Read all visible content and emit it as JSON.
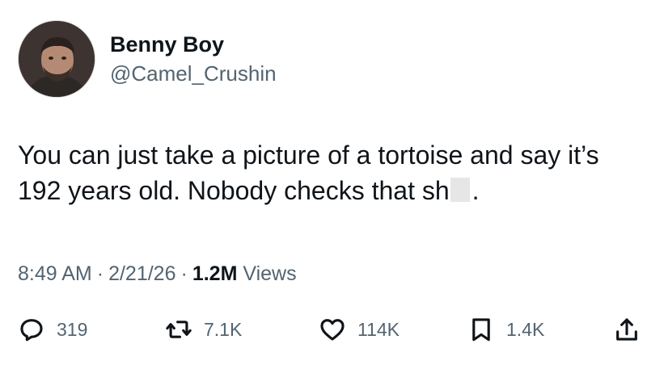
{
  "author": {
    "display_name": "Benny Boy",
    "handle": "@Camel_Crushin"
  },
  "tweet": {
    "text_part1": "You can just take a picture of a tortoise and say it’s 192 years old. Nobody checks that sh",
    "text_part2": "."
  },
  "meta": {
    "time": "8:49 AM",
    "date": "2/21/26",
    "views_count": "1.2M",
    "views_label": "Views",
    "separator": "·"
  },
  "actions": {
    "replies": "319",
    "reposts": "7.1K",
    "likes": "114K",
    "bookmarks": "1.4K"
  },
  "icons": [
    "reply-icon",
    "repost-icon",
    "like-icon",
    "bookmark-icon",
    "share-icon"
  ]
}
